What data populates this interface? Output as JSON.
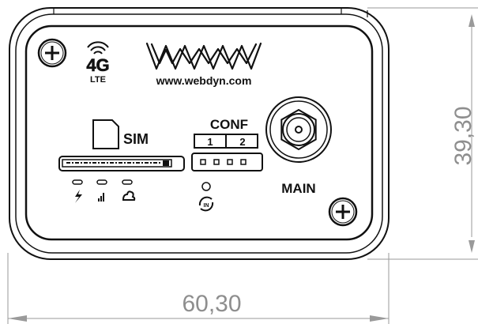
{
  "device": {
    "brand_url": "www.webdyn.com",
    "network_badge": "4G",
    "network_sub": "LTE",
    "sim_label": "SIM",
    "conf_label": "CONF",
    "conf_switch_1": "1",
    "conf_switch_2": "2",
    "antenna_label": "MAIN"
  },
  "dimensions": {
    "width": "60,30",
    "height": "39,30"
  },
  "icons": {
    "logo": "webdyn-logo-icon",
    "signal": "wifi-signal-icon",
    "sim": "sim-card-icon",
    "power": "lightning-icon",
    "network": "signal-bars-icon",
    "cloud": "cloud-icon",
    "reset": "reset-icon",
    "screw": "screw-icon",
    "antenna": "antenna-connector-icon"
  }
}
